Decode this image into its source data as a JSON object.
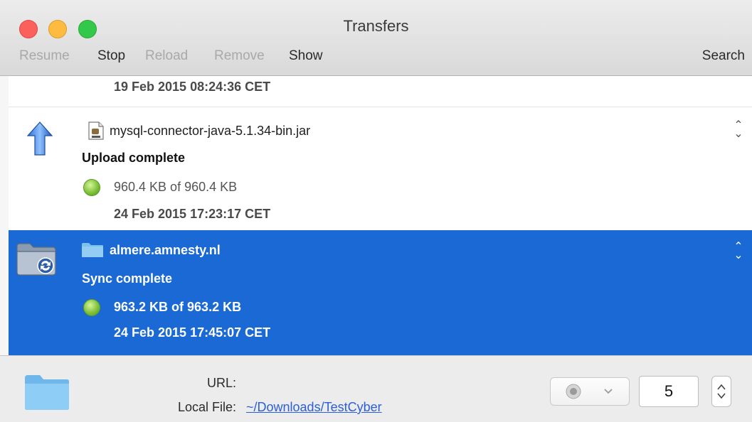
{
  "window": {
    "title": "Transfers"
  },
  "toolbar": {
    "resume_label": "Resume",
    "stop_label": "Stop",
    "reload_label": "Reload",
    "remove_label": "Remove",
    "show_label": "Show",
    "search_label": "Search"
  },
  "transfers": [
    {
      "date": "19 Feb 2015 08:24:36 CET"
    },
    {
      "direction_icon": "upload-arrow-icon",
      "file_icon": "jar-file-icon",
      "filename": "mysql-connector-java-5.1.34-bin.jar",
      "status": "Upload complete",
      "size": "960.4 KB of 960.4 KB",
      "date": "24 Feb 2015 17:23:17 CET",
      "selected": false
    },
    {
      "direction_icon": "sync-folder-icon",
      "file_icon": "folder-icon",
      "filename": "almere.amnesty.nl",
      "status": "Sync complete",
      "size": "963.2 KB of 963.2 KB",
      "date": "24 Feb 2015 17:45:07 CET",
      "selected": true
    }
  ],
  "details": {
    "url_label": "URL:",
    "local_file_label": "Local File:",
    "local_file_value": "~/Downloads/TestCyber",
    "connections_value": "5"
  },
  "colors": {
    "selection": "#1a69d4",
    "status_ok": "#7fc23a",
    "link": "#2b5fd9"
  }
}
